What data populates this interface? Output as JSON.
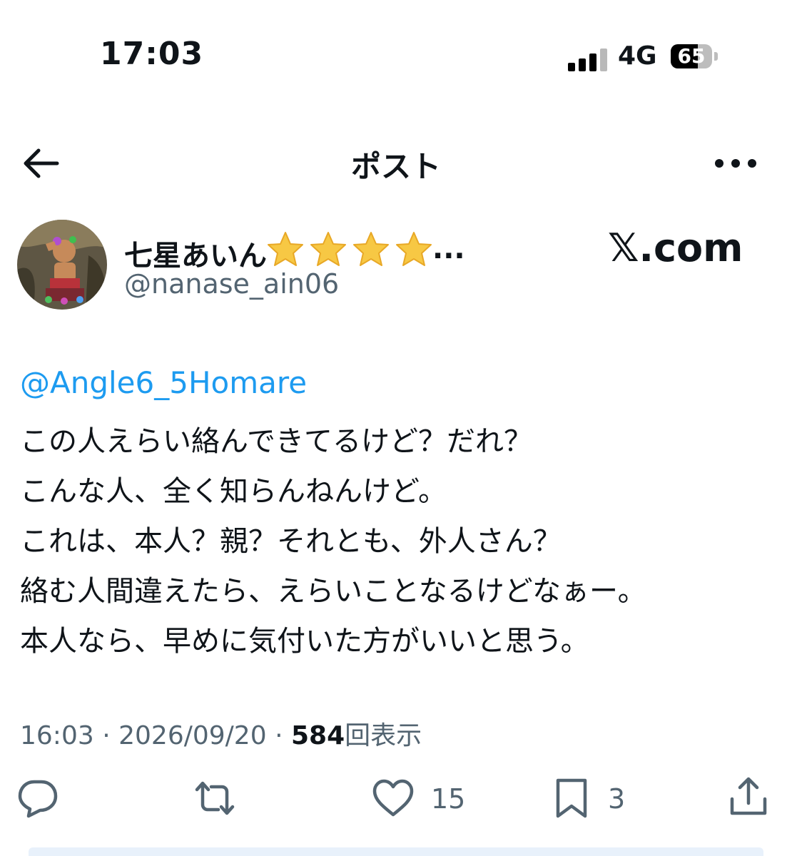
{
  "status_bar": {
    "time": "17:03",
    "network": "4G",
    "battery_level": 65,
    "battery_text": "65",
    "signal_bars": 4
  },
  "header": {
    "title": "ポスト",
    "back_icon": "arrow-left-icon",
    "more_icon": "ellipsis-icon"
  },
  "author": {
    "display_name": "七星あいん",
    "emoji_stars": [
      "star-emoji",
      "star-emoji",
      "star-emoji",
      "star-emoji"
    ],
    "truncation": "...",
    "handle": "@nanase_ain06"
  },
  "brand": "𝕏.com",
  "post": {
    "reply_to": "@Angle6_5Homare",
    "lines": [
      "この人えらい絡んできてるけど？だれ？",
      "こんな人、全く知らんねんけど。",
      "これは、本人？親？それとも、外人さん？",
      "絡む人間違えたら、えらいことなるけどなぁー。",
      "本人なら、早めに気付いた方がいいと思う。"
    ]
  },
  "meta": {
    "time": "16:03",
    "sep1": "·",
    "date": "2026/09/20",
    "sep2": "·",
    "views": "584",
    "views_label": "回表示"
  },
  "actions": {
    "reply_icon": "comment-icon",
    "repost_icon": "repost-icon",
    "like_icon": "heart-icon",
    "like_count": "15",
    "bookmark_icon": "bookmark-icon",
    "bookmark_count": "3",
    "share_icon": "share-icon"
  },
  "colors": {
    "link": "#1d9bf0",
    "secondary_text": "#536471",
    "primary_text": "#0f1419",
    "star": "#f7c844"
  }
}
